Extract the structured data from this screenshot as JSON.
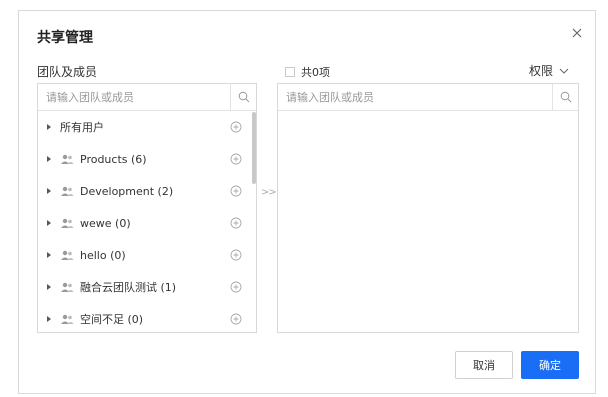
{
  "dialog": {
    "title": "共享管理",
    "close_icon": "close-icon"
  },
  "left": {
    "label": "团队及成员",
    "search_placeholder": "请输入团队或成员",
    "items": [
      {
        "label": "所有用户",
        "has_user_icon": false
      },
      {
        "label": "Products (6)",
        "has_user_icon": true
      },
      {
        "label": "Development (2)",
        "has_user_icon": true
      },
      {
        "label": "wewe (0)",
        "has_user_icon": true
      },
      {
        "label": "hello (0)",
        "has_user_icon": true
      },
      {
        "label": "融合云团队测试 (1)",
        "has_user_icon": true
      },
      {
        "label": "空间不足 (0)",
        "has_user_icon": true
      }
    ]
  },
  "transfer": {
    "label": ">>"
  },
  "right": {
    "select_all_label": "共0项",
    "permission_label": "权限",
    "search_placeholder": "请输入团队或成员"
  },
  "buttons": {
    "cancel": "取消",
    "ok": "确定"
  },
  "colors": {
    "primary": "#1a6ef5",
    "border": "#d9d9d9"
  }
}
